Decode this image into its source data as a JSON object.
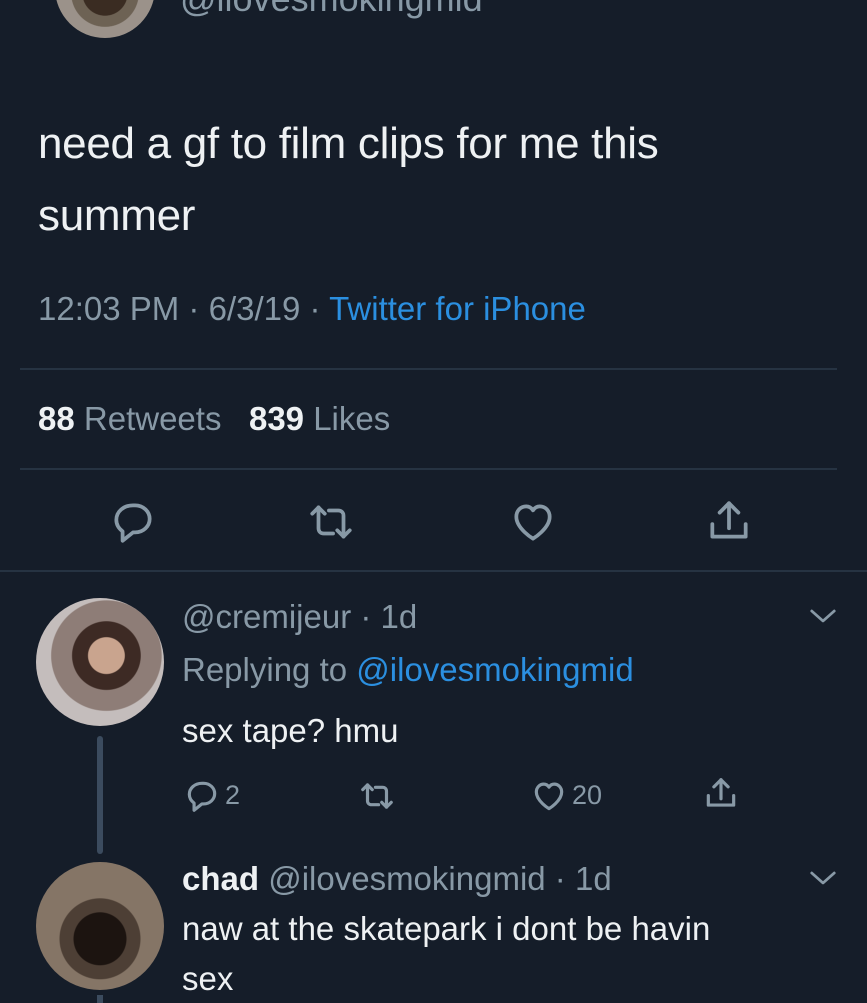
{
  "top": {
    "handle": "@ilovesmokingmid"
  },
  "tweet": {
    "text_line1": "need a gf to film clips for me this",
    "text_line2": "summer",
    "time": "12:03 PM",
    "date": "6/3/19",
    "source": "Twitter for iPhone",
    "retweets_count": "88",
    "retweets_label": "Retweets",
    "likes_count": "839",
    "likes_label": "Likes"
  },
  "reply1": {
    "handle": "@cremijeur",
    "age": "1d",
    "replying_prefix": "Replying to",
    "replying_to": "@ilovesmokingmid",
    "text": "sex tape? hmu",
    "reply_count": "2",
    "like_count": "20"
  },
  "reply2": {
    "name": "chad",
    "handle": "@ilovesmokingmid",
    "age": "1d",
    "text_line1": "naw at the skatepark i dont be havin",
    "text_line2": "sex"
  },
  "colors": {
    "background": "#151d29",
    "accent": "#2b8fe0",
    "muted": "#8899a6"
  },
  "icons": [
    "reply-icon",
    "retweet-icon",
    "like-icon",
    "share-icon",
    "chevron-down-icon"
  ]
}
